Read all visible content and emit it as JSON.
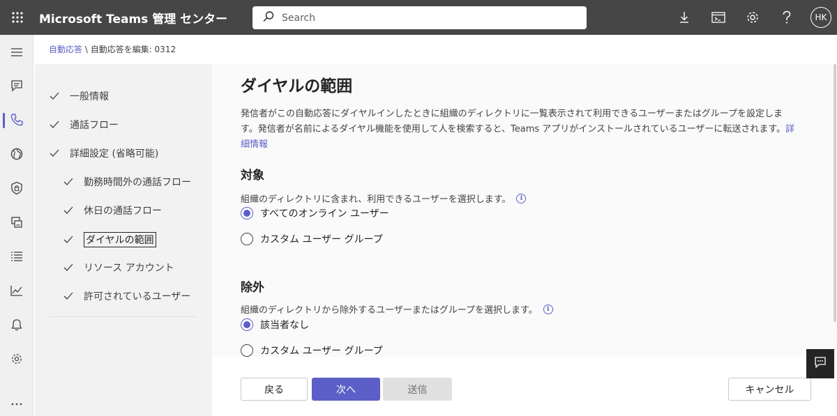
{
  "header": {
    "app_title": "Microsoft Teams 管理 センター",
    "search_placeholder": "Search",
    "avatar_initials": "HK"
  },
  "breadcrumb": {
    "parent": "自動応答",
    "separator": " \\ ",
    "current": "自動応答を編集: 0312"
  },
  "steps": [
    {
      "label": "一般情報",
      "completed": true
    },
    {
      "label": "通話フロー",
      "completed": true
    },
    {
      "label": "詳細設定 (省略可能)",
      "completed": true
    },
    {
      "label": "勤務時間外の通話フロー",
      "completed": true
    },
    {
      "label": "休日の通話フロー",
      "completed": true
    },
    {
      "label": "ダイヤルの範囲",
      "completed": true,
      "current": true
    },
    {
      "label": "リソース アカウント",
      "completed": true
    },
    {
      "label": "許可されているユーザー",
      "completed": true
    }
  ],
  "main": {
    "title": "ダイヤルの範囲",
    "description": "発信者がこの自動応答にダイヤルインしたときに組織のディレクトリに一覧表示されて利用できるユーザーまたはグループを設定します。発信者が名前によるダイヤル機能を使用して人を検索すると、Teams アプリがインストールされているユーザーに転送されます。",
    "learn_more": "詳細情報",
    "include": {
      "title": "対象",
      "description": "組織のディレクトリに含まれ、利用できるユーザーを選択します。",
      "options": [
        {
          "label": "すべてのオンライン ユーザー",
          "checked": true
        },
        {
          "label": "カスタム ユーザー グループ",
          "checked": false
        }
      ]
    },
    "exclude": {
      "title": "除外",
      "description": "組織のディレクトリから除外するユーザーまたはグループを選択します。",
      "options": [
        {
          "label": "該当者なし",
          "checked": true
        },
        {
          "label": "カスタム ユーザー グループ",
          "checked": false
        }
      ]
    }
  },
  "footer": {
    "back": "戻る",
    "next": "次へ",
    "submit": "送信",
    "cancel": "キャンセル"
  },
  "colors": {
    "accent": "#5b5fc7",
    "header_bg": "#464646"
  },
  "icons": {
    "rail": [
      "hamburger-icon",
      "chat-icon",
      "phone-icon",
      "globe-icon",
      "shield-icon",
      "devices-icon",
      "list-icon",
      "analytics-icon",
      "bell-icon",
      "settings-icon",
      "more-icon"
    ]
  }
}
